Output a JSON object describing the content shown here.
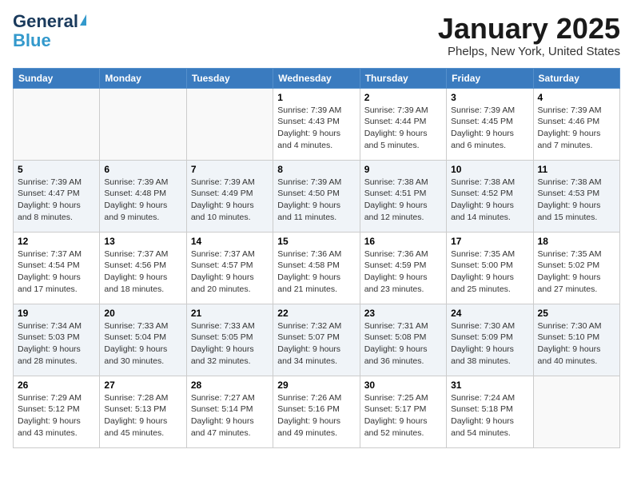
{
  "header": {
    "logo_general": "General",
    "logo_blue": "Blue",
    "month": "January 2025",
    "location": "Phelps, New York, United States"
  },
  "days_of_week": [
    "Sunday",
    "Monday",
    "Tuesday",
    "Wednesday",
    "Thursday",
    "Friday",
    "Saturday"
  ],
  "weeks": [
    [
      {
        "day": "",
        "sunrise": "",
        "sunset": "",
        "daylight": ""
      },
      {
        "day": "",
        "sunrise": "",
        "sunset": "",
        "daylight": ""
      },
      {
        "day": "",
        "sunrise": "",
        "sunset": "",
        "daylight": ""
      },
      {
        "day": "1",
        "sunrise": "Sunrise: 7:39 AM",
        "sunset": "Sunset: 4:43 PM",
        "daylight": "Daylight: 9 hours and 4 minutes."
      },
      {
        "day": "2",
        "sunrise": "Sunrise: 7:39 AM",
        "sunset": "Sunset: 4:44 PM",
        "daylight": "Daylight: 9 hours and 5 minutes."
      },
      {
        "day": "3",
        "sunrise": "Sunrise: 7:39 AM",
        "sunset": "Sunset: 4:45 PM",
        "daylight": "Daylight: 9 hours and 6 minutes."
      },
      {
        "day": "4",
        "sunrise": "Sunrise: 7:39 AM",
        "sunset": "Sunset: 4:46 PM",
        "daylight": "Daylight: 9 hours and 7 minutes."
      }
    ],
    [
      {
        "day": "5",
        "sunrise": "Sunrise: 7:39 AM",
        "sunset": "Sunset: 4:47 PM",
        "daylight": "Daylight: 9 hours and 8 minutes."
      },
      {
        "day": "6",
        "sunrise": "Sunrise: 7:39 AM",
        "sunset": "Sunset: 4:48 PM",
        "daylight": "Daylight: 9 hours and 9 minutes."
      },
      {
        "day": "7",
        "sunrise": "Sunrise: 7:39 AM",
        "sunset": "Sunset: 4:49 PM",
        "daylight": "Daylight: 9 hours and 10 minutes."
      },
      {
        "day": "8",
        "sunrise": "Sunrise: 7:39 AM",
        "sunset": "Sunset: 4:50 PM",
        "daylight": "Daylight: 9 hours and 11 minutes."
      },
      {
        "day": "9",
        "sunrise": "Sunrise: 7:38 AM",
        "sunset": "Sunset: 4:51 PM",
        "daylight": "Daylight: 9 hours and 12 minutes."
      },
      {
        "day": "10",
        "sunrise": "Sunrise: 7:38 AM",
        "sunset": "Sunset: 4:52 PM",
        "daylight": "Daylight: 9 hours and 14 minutes."
      },
      {
        "day": "11",
        "sunrise": "Sunrise: 7:38 AM",
        "sunset": "Sunset: 4:53 PM",
        "daylight": "Daylight: 9 hours and 15 minutes."
      }
    ],
    [
      {
        "day": "12",
        "sunrise": "Sunrise: 7:37 AM",
        "sunset": "Sunset: 4:54 PM",
        "daylight": "Daylight: 9 hours and 17 minutes."
      },
      {
        "day": "13",
        "sunrise": "Sunrise: 7:37 AM",
        "sunset": "Sunset: 4:56 PM",
        "daylight": "Daylight: 9 hours and 18 minutes."
      },
      {
        "day": "14",
        "sunrise": "Sunrise: 7:37 AM",
        "sunset": "Sunset: 4:57 PM",
        "daylight": "Daylight: 9 hours and 20 minutes."
      },
      {
        "day": "15",
        "sunrise": "Sunrise: 7:36 AM",
        "sunset": "Sunset: 4:58 PM",
        "daylight": "Daylight: 9 hours and 21 minutes."
      },
      {
        "day": "16",
        "sunrise": "Sunrise: 7:36 AM",
        "sunset": "Sunset: 4:59 PM",
        "daylight": "Daylight: 9 hours and 23 minutes."
      },
      {
        "day": "17",
        "sunrise": "Sunrise: 7:35 AM",
        "sunset": "Sunset: 5:00 PM",
        "daylight": "Daylight: 9 hours and 25 minutes."
      },
      {
        "day": "18",
        "sunrise": "Sunrise: 7:35 AM",
        "sunset": "Sunset: 5:02 PM",
        "daylight": "Daylight: 9 hours and 27 minutes."
      }
    ],
    [
      {
        "day": "19",
        "sunrise": "Sunrise: 7:34 AM",
        "sunset": "Sunset: 5:03 PM",
        "daylight": "Daylight: 9 hours and 28 minutes."
      },
      {
        "day": "20",
        "sunrise": "Sunrise: 7:33 AM",
        "sunset": "Sunset: 5:04 PM",
        "daylight": "Daylight: 9 hours and 30 minutes."
      },
      {
        "day": "21",
        "sunrise": "Sunrise: 7:33 AM",
        "sunset": "Sunset: 5:05 PM",
        "daylight": "Daylight: 9 hours and 32 minutes."
      },
      {
        "day": "22",
        "sunrise": "Sunrise: 7:32 AM",
        "sunset": "Sunset: 5:07 PM",
        "daylight": "Daylight: 9 hours and 34 minutes."
      },
      {
        "day": "23",
        "sunrise": "Sunrise: 7:31 AM",
        "sunset": "Sunset: 5:08 PM",
        "daylight": "Daylight: 9 hours and 36 minutes."
      },
      {
        "day": "24",
        "sunrise": "Sunrise: 7:30 AM",
        "sunset": "Sunset: 5:09 PM",
        "daylight": "Daylight: 9 hours and 38 minutes."
      },
      {
        "day": "25",
        "sunrise": "Sunrise: 7:30 AM",
        "sunset": "Sunset: 5:10 PM",
        "daylight": "Daylight: 9 hours and 40 minutes."
      }
    ],
    [
      {
        "day": "26",
        "sunrise": "Sunrise: 7:29 AM",
        "sunset": "Sunset: 5:12 PM",
        "daylight": "Daylight: 9 hours and 43 minutes."
      },
      {
        "day": "27",
        "sunrise": "Sunrise: 7:28 AM",
        "sunset": "Sunset: 5:13 PM",
        "daylight": "Daylight: 9 hours and 45 minutes."
      },
      {
        "day": "28",
        "sunrise": "Sunrise: 7:27 AM",
        "sunset": "Sunset: 5:14 PM",
        "daylight": "Daylight: 9 hours and 47 minutes."
      },
      {
        "day": "29",
        "sunrise": "Sunrise: 7:26 AM",
        "sunset": "Sunset: 5:16 PM",
        "daylight": "Daylight: 9 hours and 49 minutes."
      },
      {
        "day": "30",
        "sunrise": "Sunrise: 7:25 AM",
        "sunset": "Sunset: 5:17 PM",
        "daylight": "Daylight: 9 hours and 52 minutes."
      },
      {
        "day": "31",
        "sunrise": "Sunrise: 7:24 AM",
        "sunset": "Sunset: 5:18 PM",
        "daylight": "Daylight: 9 hours and 54 minutes."
      },
      {
        "day": "",
        "sunrise": "",
        "sunset": "",
        "daylight": ""
      }
    ]
  ]
}
